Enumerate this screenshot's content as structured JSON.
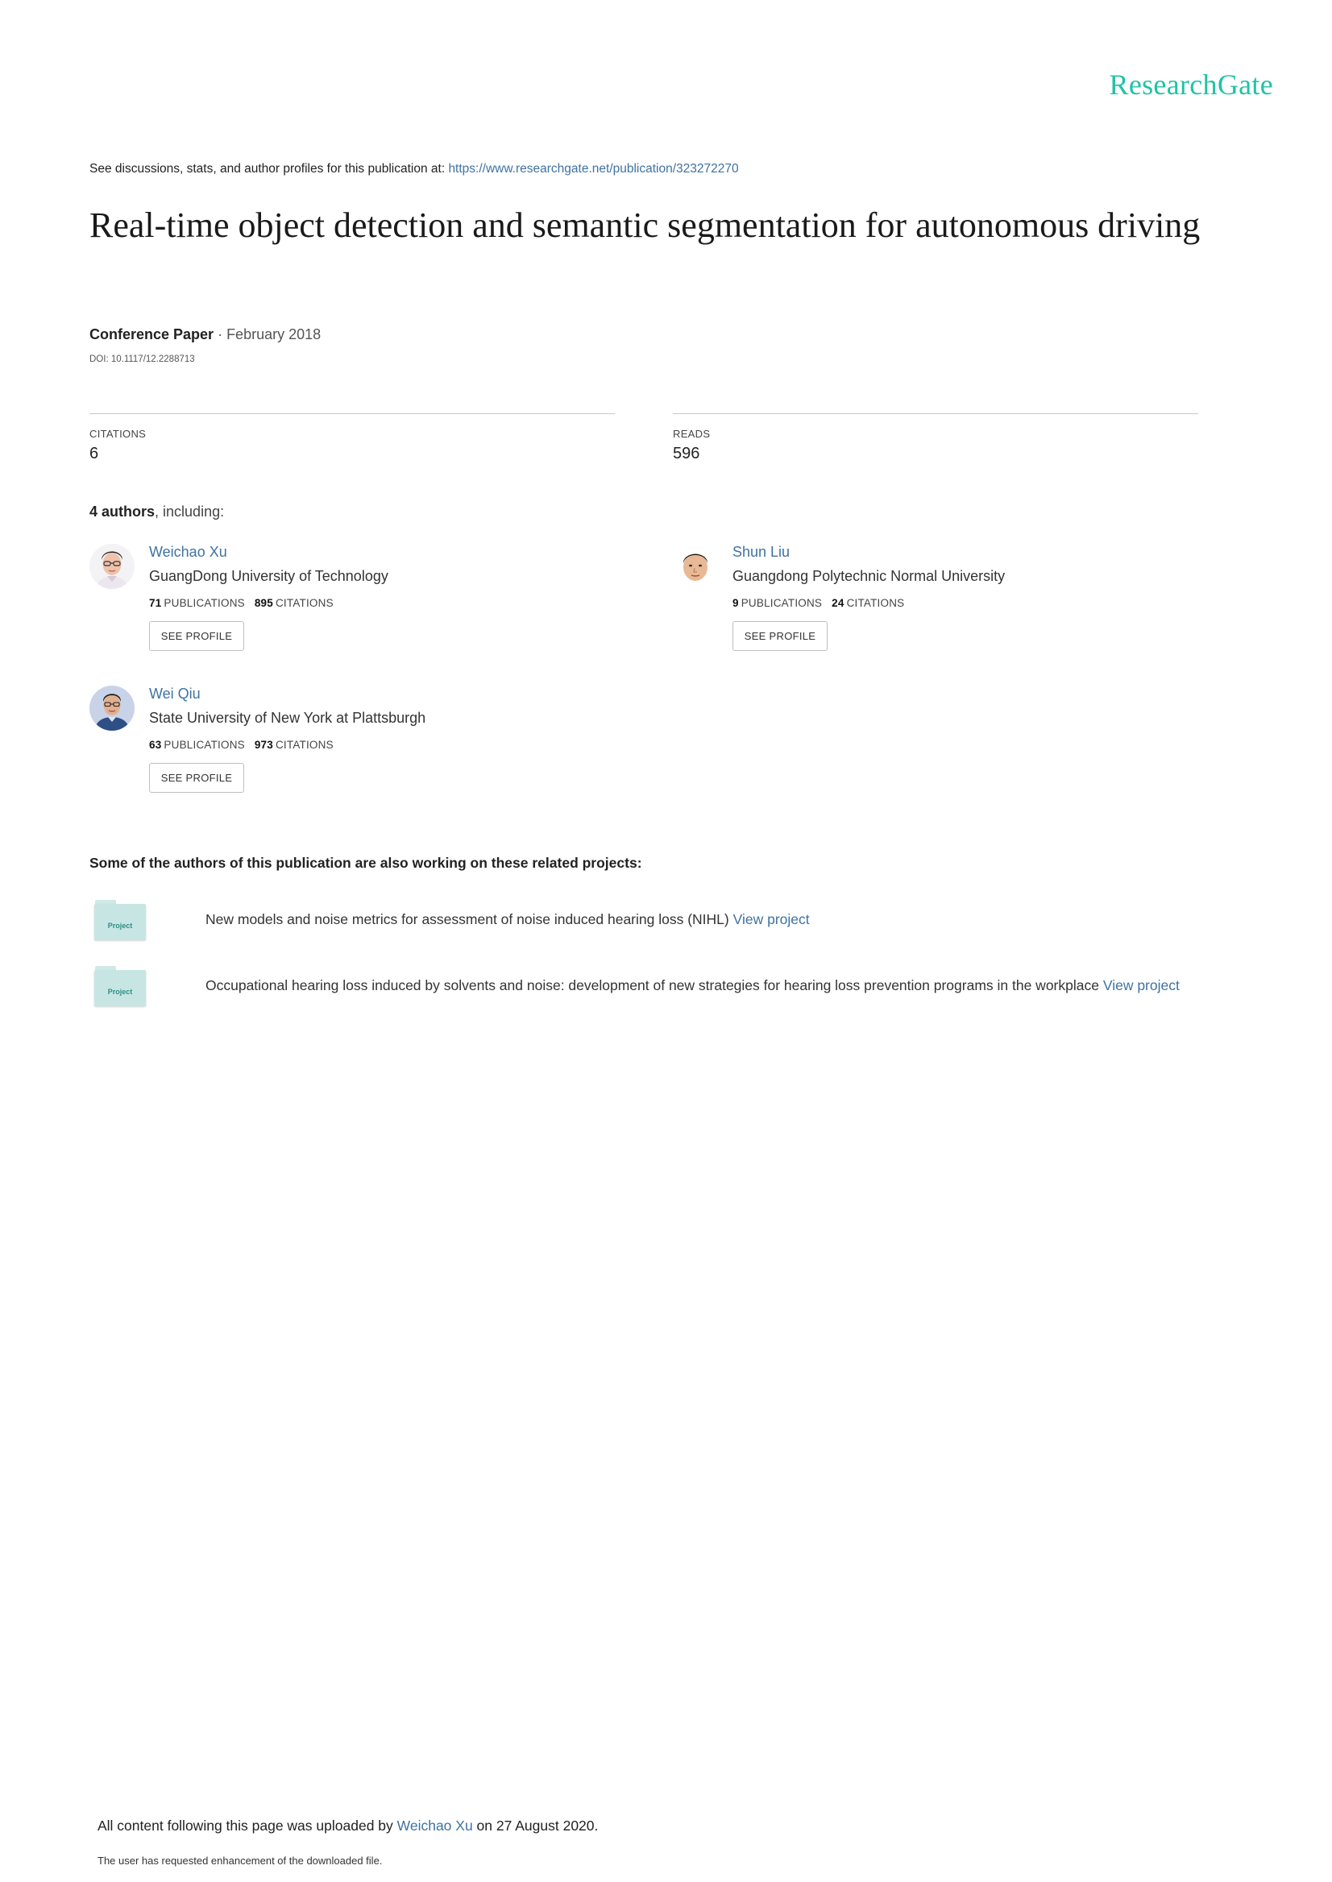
{
  "brand": {
    "logo": "ResearchGate",
    "accent_color": "#21c2a6",
    "link_color": "#3f72a1"
  },
  "header": {
    "discuss_text": "See discussions, stats, and author profiles for this publication at: ",
    "publication_url": "https://www.researchgate.net/publication/323272270"
  },
  "publication": {
    "title": "Real-time object detection and semantic segmentation for autonomous driving",
    "type": "Conference Paper",
    "separator": " · ",
    "date": "February 2018",
    "doi": "DOI: 10.1117/12.2288713"
  },
  "stats": {
    "citations_label": "CITATIONS",
    "citations_value": "6",
    "reads_label": "READS",
    "reads_value": "596"
  },
  "authors_section": {
    "count_text": "4 authors",
    "suffix": ", including:"
  },
  "authors": [
    {
      "name": "Weichao Xu",
      "institution": "GuangDong University of Technology",
      "publications": "71",
      "publications_label": "PUBLICATIONS",
      "citations": "895",
      "citations_label": "CITATIONS",
      "button": "SEE PROFILE"
    },
    {
      "name": "Shun Liu",
      "institution": "Guangdong Polytechnic Normal University",
      "publications": "9",
      "publications_label": "PUBLICATIONS",
      "citations": "24",
      "citations_label": "CITATIONS",
      "button": "SEE PROFILE"
    },
    {
      "name": "Wei Qiu",
      "institution": "State University of New York at Plattsburgh",
      "publications": "63",
      "publications_label": "PUBLICATIONS",
      "citations": "973",
      "citations_label": "CITATIONS",
      "button": "SEE PROFILE"
    }
  ],
  "related": {
    "heading": "Some of the authors of this publication are also working on these related projects:",
    "projects": [
      {
        "icon_label": "Project",
        "text": "New models and noise metrics for assessment of noise induced hearing loss (NIHL)",
        "link": "View project"
      },
      {
        "icon_label": "Project",
        "text": "Occupational hearing loss induced by solvents and noise: development of new strategies for hearing loss prevention programs in the workplace",
        "link": "View project"
      }
    ]
  },
  "footer": {
    "uploaded_prefix": "All content following this page was uploaded by ",
    "uploader": "Weichao Xu",
    "uploaded_suffix": " on 27 August 2020.",
    "enhancement_note": "The user has requested enhancement of the downloaded file."
  }
}
